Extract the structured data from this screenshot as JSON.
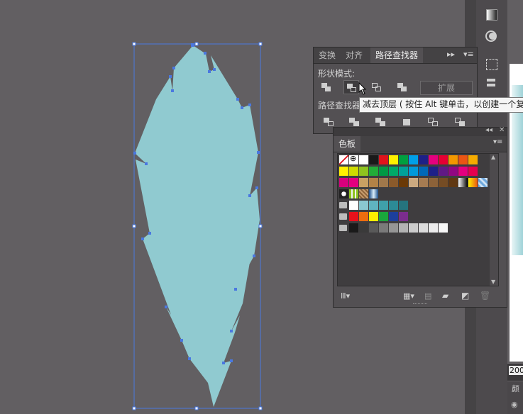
{
  "colors": {
    "background": "#625f62",
    "shape_fill": "#90cad0",
    "selection": "#4a78e0",
    "panel": "#535053"
  },
  "pathfinder": {
    "tabs": [
      "变换",
      "对齐",
      "路径查找器"
    ],
    "active_tab": "路径查找器",
    "shape_modes_label": "形状模式:",
    "pathfinders_label": "路径查找器",
    "expand_label": "扩展",
    "tooltip": "减去顶层 ( 按住 Alt 键单击，以创建一个复",
    "menu_icons": [
      "collapse-arrows-icon",
      "panel-menu-icon"
    ],
    "pressed_mode": "minus-front"
  },
  "swatches": {
    "title": "色板",
    "rows": [
      [
        "none",
        "registration",
        "#ffffff",
        "#1a1a1a",
        "#e0131c",
        "#fff100",
        "#00a040",
        "#009fe8",
        "#1d2087",
        "#e4007f",
        "#e60033",
        "#f39800",
        "#ea5514",
        "#f6ab00"
      ],
      [
        "#fff100",
        "#cfdb00",
        "#8fc31f",
        "#22ac38",
        "#009944",
        "#00a968",
        "#00a199",
        "#0099d9",
        "#0068b7",
        "#1d2088",
        "#601986",
        "#920783",
        "#e4007f",
        "#e5004f"
      ],
      [
        "#d7007d",
        "#e4007f",
        "#c9a063",
        "#b28247",
        "#a0784b",
        "#8a5a2b",
        "#6a3906",
        "#ccaa80",
        "#a67c52",
        "#8c6239",
        "#754c24",
        "#603813",
        "gradient-bw",
        "gradient-orange",
        "gradient-pattern"
      ],
      [
        "pattern-1",
        "pattern-2",
        "pattern-3",
        "gradient-blue"
      ],
      [
        "#ffffff",
        "#8ac8d0",
        "#5fb4c0",
        "#3fa0aa",
        "#2c8b96",
        "#25747e"
      ],
      [
        "#e8111b",
        "#ee6d0f",
        "#ffed00",
        "#1aa63c",
        "#1d3f9c",
        "#7b2d8e"
      ],
      [
        "#1a1a1a",
        "#3a3a3a",
        "#595959",
        "#7a7a7a",
        "#969696",
        "#b3b3b3",
        "#cccccc",
        "#dcdcdc",
        "#ececec",
        "#f7f7f7"
      ]
    ],
    "footer_icons": [
      "swatch-libraries-icon",
      "show-swatch-kinds-icon",
      "swatch-options-icon",
      "new-color-group-icon",
      "new-swatch-icon",
      "delete-swatch-icon"
    ]
  },
  "status": {
    "zoom_value": "200",
    "color_label": "颜"
  }
}
